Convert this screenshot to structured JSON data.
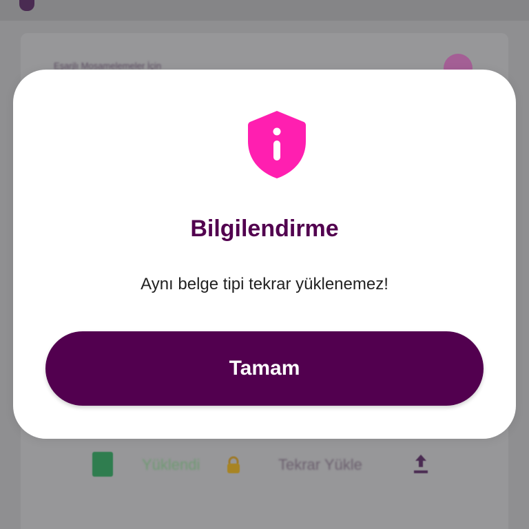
{
  "background": {
    "card_title": "Eşarjlı Mosamelemeler İçin",
    "file_status": "Yüklendi",
    "reupload_label": "Tekrar Yükle",
    "icons": [
      "file-icon",
      "lock-icon",
      "upload-icon"
    ]
  },
  "dialog": {
    "icon": "shield-info-icon",
    "title": "Bilgilendirme",
    "message": "Aynı belge tipi tekrar yüklenemez!",
    "button_label": "Tamam"
  },
  "colors": {
    "primary": "#52004f",
    "accent_pink": "#ff1fb0",
    "overlay": "#8f8f91",
    "dialog_bg": "#ffffff"
  }
}
